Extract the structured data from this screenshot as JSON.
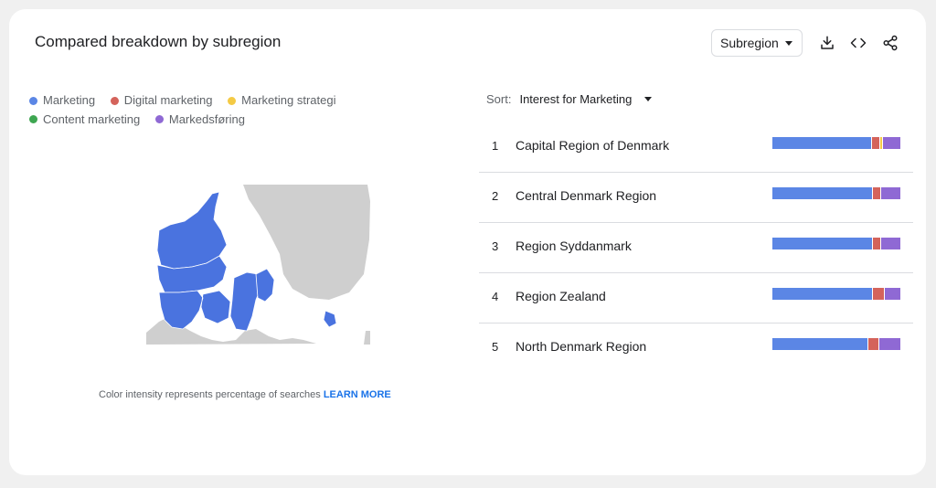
{
  "header": {
    "title": "Compared breakdown by subregion",
    "region_select": "Subregion"
  },
  "legend": [
    {
      "label": "Marketing",
      "color": "#5b86e5"
    },
    {
      "label": "Digital marketing",
      "color": "#d4635b"
    },
    {
      "label": "Marketing strategi",
      "color": "#f4ca45"
    },
    {
      "label": "Content marketing",
      "color": "#3ea651"
    },
    {
      "label": "Markedsføring",
      "color": "#8f69d4"
    }
  ],
  "map": {
    "caption": "Color intensity represents percentage of searches",
    "learn_more": "LEARN MORE",
    "region_color": "#4a73df",
    "land_color": "#cfcfcf"
  },
  "sort": {
    "label": "Sort:",
    "value": "Interest for Marketing"
  },
  "regions": [
    {
      "rank": "1",
      "name": "Capital Region of Denmark",
      "shares": [
        79,
        6,
        1,
        0,
        14
      ]
    },
    {
      "rank": "2",
      "name": "Central Denmark Region",
      "shares": [
        79,
        6,
        0,
        0,
        15
      ]
    },
    {
      "rank": "3",
      "name": "Region Syddanmark",
      "shares": [
        79,
        6,
        0,
        0,
        15
      ]
    },
    {
      "rank": "4",
      "name": "Region Zealand",
      "shares": [
        79,
        9,
        0,
        0,
        12
      ]
    },
    {
      "rank": "5",
      "name": "North Denmark Region",
      "shares": [
        75,
        8,
        0,
        0,
        17
      ]
    }
  ]
}
